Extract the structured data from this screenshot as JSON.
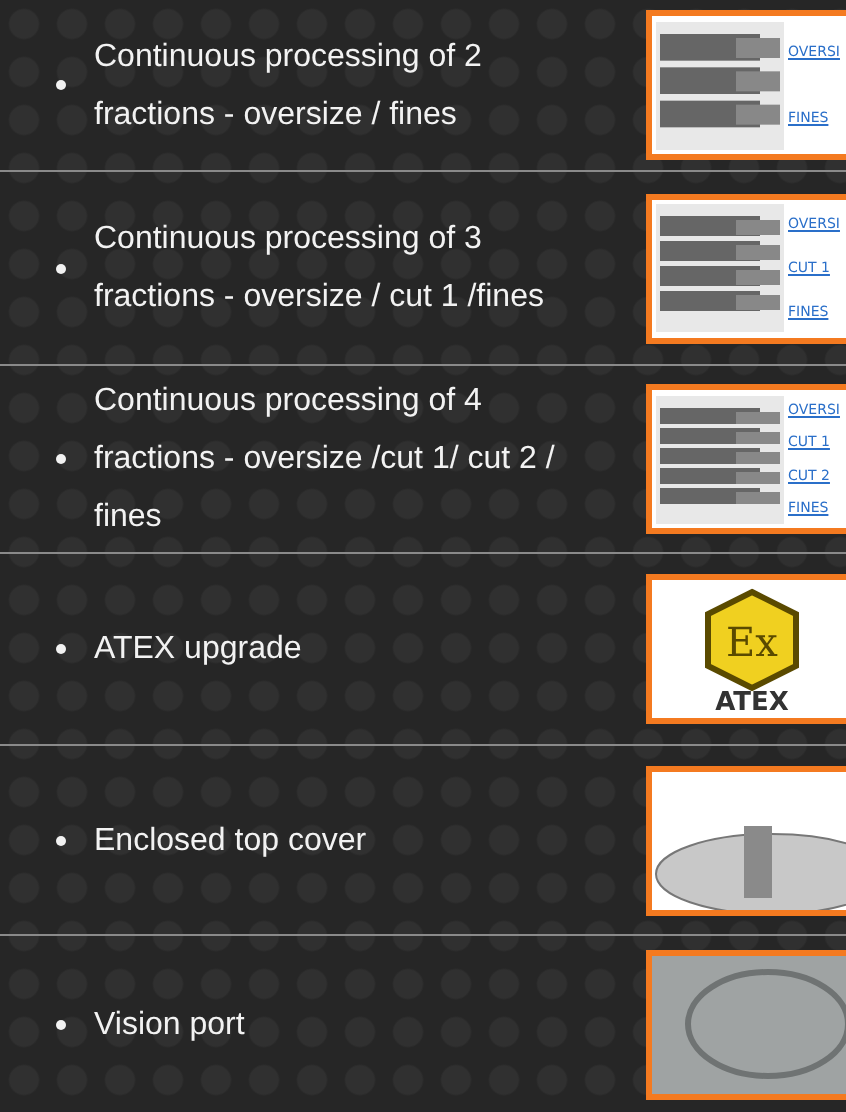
{
  "options": [
    {
      "text": "Continuous processing of 2 fractions - oversize / fines",
      "image": {
        "kind": "splitter",
        "labels": [
          "OVERSI",
          "FINES"
        ]
      }
    },
    {
      "text": "Continuous processing of 3 fractions - oversize / cut 1 /fines",
      "image": {
        "kind": "splitter",
        "labels": [
          "OVERSI",
          "CUT 1",
          "FINES"
        ]
      }
    },
    {
      "text": "Continuous processing of 4 fractions - oversize /cut 1/ cut 2 / fines",
      "image": {
        "kind": "splitter",
        "labels": [
          "OVERSI",
          "CUT 1",
          "CUT 2",
          "FINES"
        ]
      }
    },
    {
      "text": "ATEX upgrade",
      "image": {
        "kind": "atex",
        "symbol": "Ex",
        "caption": "ATEX"
      }
    },
    {
      "text": "Enclosed top cover",
      "image": {
        "kind": "cover"
      }
    },
    {
      "text": "Vision port",
      "image": {
        "kind": "port"
      }
    }
  ]
}
